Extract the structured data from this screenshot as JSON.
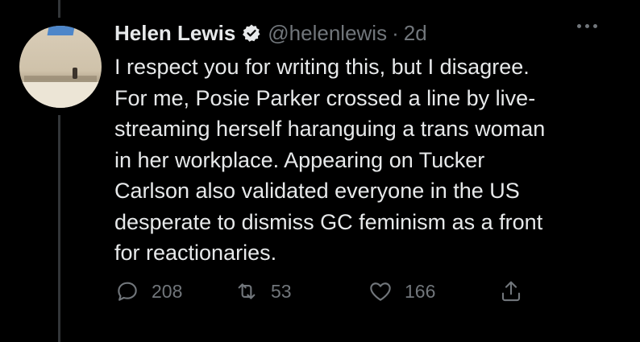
{
  "tweet": {
    "author_name": "Helen Lewis",
    "handle": "@helenlewis",
    "separator": "·",
    "time": "2d",
    "text_lines": [
      "I respect you for writing this, but I disagree.",
      "For me, Posie Parker crossed a line by live-",
      "streaming herself haranguing a trans woman",
      "in her workplace. Appearing on Tucker",
      "Carlson also validated everyone in the US",
      "desperate to dismiss GC feminism as a front",
      "for reactionaries."
    ],
    "replies": "208",
    "retweets": "53",
    "likes": "166",
    "share_icon": "share-icon"
  },
  "colors": {
    "background": "#000000",
    "text": "#e7e9ea",
    "muted": "#71767b",
    "thread_line": "#333639"
  }
}
